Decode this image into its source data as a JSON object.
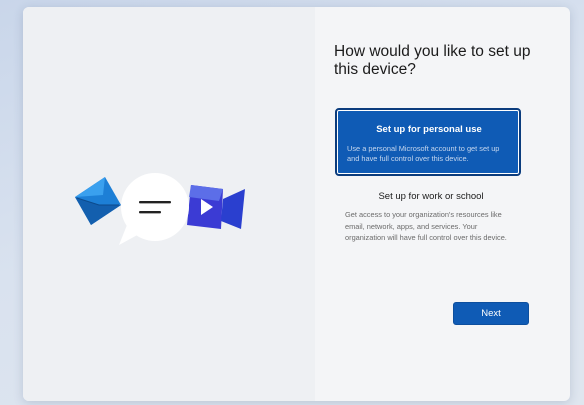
{
  "setup": {
    "title": "How would you like to set up this device?",
    "options": [
      {
        "label": "Set up for personal use",
        "description": "Use a personal Microsoft account to get set up and have full control over this device.",
        "selected": true
      },
      {
        "label": "Set up for work or school",
        "description": "Get access to your organization's resources like email, network, apps, and services. Your organization will have full control over this device.",
        "selected": false
      }
    ],
    "next_label": "Next"
  },
  "illustration": {
    "icons": [
      "mail-icon",
      "chat-bubble-icon",
      "video-icon"
    ]
  },
  "colors": {
    "accent": "#0f5bb5",
    "accent_border": "#0b3c7d",
    "window_bg": "#f4f5f7",
    "text": "#1b1b1b"
  }
}
